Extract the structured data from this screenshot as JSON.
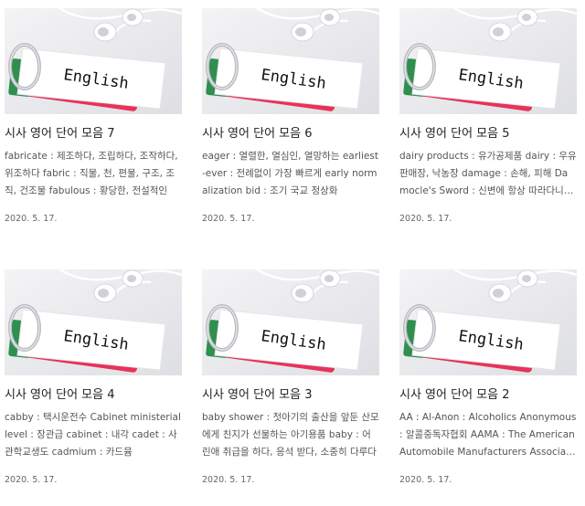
{
  "posts": [
    {
      "title": "시사 영어 단어 모음 7",
      "snippet": "fabricate : 제조하다, 조립하다, 조작하다, 위조하다 fabric : 직물, 천, 편물, 구조, 조직, 건조물 fabulous : 황당한, 전설적인",
      "date": "2020. 5. 17.",
      "thumb_text": "English",
      "thumb_icon": "english-flashcard-earphones-image"
    },
    {
      "title": "시사 영어 단어 모음 6",
      "snippet": "eager : 열렬한, 열심인, 열망하는 earliest-ever : 전례없이 가장 빠르게 early normalization bid : 조기 국교 정상화",
      "date": "2020. 5. 17.",
      "thumb_text": "English",
      "thumb_icon": "english-flashcard-earphones-image"
    },
    {
      "title": "시사 영어 단어 모음 5",
      "snippet": "dairy products : 유가공제품 dairy : 우유판매장, 낙농장 damage : 손해, 피해 Damocle's Sword : 신변에 항상 따라다니는 위험",
      "date": "2020. 5. 17.",
      "thumb_text": "English",
      "thumb_icon": "english-flashcard-earphones-image"
    },
    {
      "title": "시사 영어 단어 모음 4",
      "snippet": "cabby : 택시운전수 Cabinet ministerial level : 장관급 cabinet : 내각 cadet : 사관학교생도 cadmium : 카드뮴",
      "date": "2020. 5. 17.",
      "thumb_text": "English",
      "thumb_icon": "english-flashcard-earphones-image"
    },
    {
      "title": "시사 영어 단어 모음 3",
      "snippet": "baby shower : 첫아기의 출산을 앞둔 산모에게 친지가 선물하는 아기용품 baby : 어린애 취급을 하다, 응석 받다, 소중히 다루다",
      "date": "2020. 5. 17.",
      "thumb_text": "English",
      "thumb_icon": "english-flashcard-earphones-image"
    },
    {
      "title": "시사 영어 단어 모음 2",
      "snippet": "AA : Al-Anon : Alcoholics Anonymous : 알콜중독자협회 AAMA : The American Automobile Manufacturers Association",
      "date": "2020. 5. 17.",
      "thumb_text": "English",
      "thumb_icon": "english-flashcard-earphones-image"
    }
  ],
  "colors": {
    "title": "#222222",
    "snippet": "#555555",
    "date": "#666666",
    "card_pink": "#e8325a",
    "card_green": "#2f8f4e"
  }
}
